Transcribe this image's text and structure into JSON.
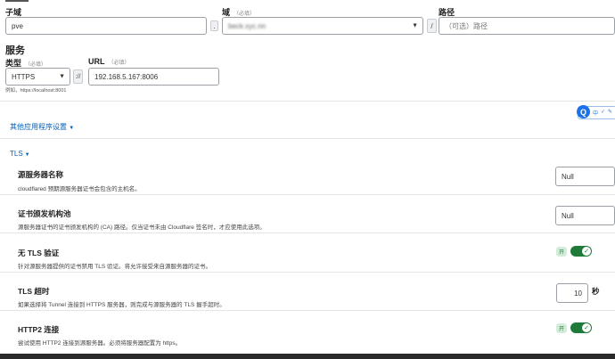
{
  "route": {
    "subdomain": {
      "label": "子域",
      "value": "pve"
    },
    "domain": {
      "label": "域",
      "required": "（必填）",
      "value": "beck.xyc.nn"
    },
    "dot": ".",
    "slash": "/",
    "path": {
      "label": "路径",
      "placeholder": "（可选）路径"
    }
  },
  "service": {
    "heading": "服务",
    "type": {
      "label": "类型",
      "required": "（必填）",
      "value": "HTTPS"
    },
    "scheme_sep": "://",
    "url": {
      "label": "URL",
      "required": "（必填）",
      "value": "192.168.5.167:8006"
    },
    "example": "例如，https://localhost:8001"
  },
  "other_settings": {
    "label": "其他应用程序设置",
    "arrow": "▼"
  },
  "tls": {
    "label": "TLS",
    "arrow": "▼"
  },
  "rows": [
    {
      "title": "源服务器名称",
      "desc": "cloudflared 预期源服务器证书会包含的主机名。",
      "value": "Null"
    },
    {
      "title": "证书颁发机构池",
      "desc": "源服务器证书的证书颁发机构的 (CA) 路径。仅当证书未由 Cloudflare 签名时，才应使用此选项。",
      "value": "Null"
    },
    {
      "title": "无 TLS 验证",
      "desc": "针对源服务器提供的证书禁用 TLS 验证。将允许接受来自源服务器的证书。",
      "toggle_label": "开",
      "toggle_icon": "✓"
    },
    {
      "title": "TLS 超时",
      "desc": "如果选择将 Tunnel 连接到 HTTPS 服务器，则完成与源服务器的 TLS 握手超时。",
      "value": "10",
      "unit": "秒"
    },
    {
      "title": "HTTP2 连接",
      "desc": "尝试使用 HTTP2 连接到源服务器。必须将服务器配置为 https。",
      "toggle_label": "开",
      "toggle_icon": "✓"
    }
  ],
  "ime_toolbar": {
    "logo": "Q",
    "items": [
      "中",
      "✓",
      "✎",
      "⚙"
    ]
  },
  "colors": {
    "accent": "#0a5fb3",
    "toggle": "#1f7a3a",
    "ime": "#1a73e8"
  }
}
